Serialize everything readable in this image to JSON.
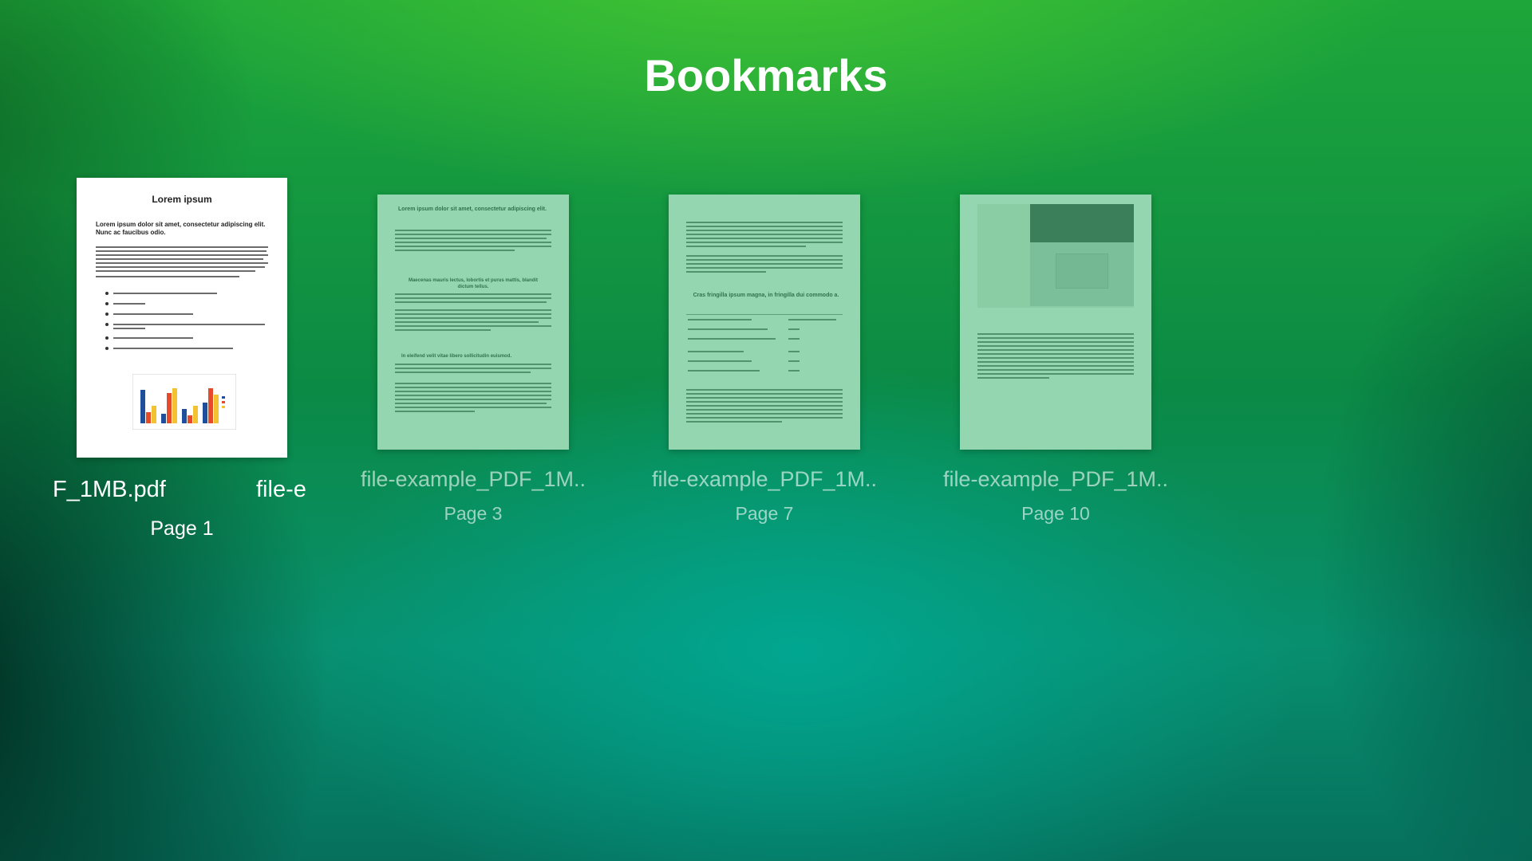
{
  "header": {
    "title": "Bookmarks"
  },
  "bookmarks": [
    {
      "file_marquee_left": "F_1MB.pdf",
      "file_marquee_right": "file-e",
      "page": "Page 1",
      "preview": {
        "heading": "Lorem ipsum",
        "subheading": "Lorem ipsum dolor sit amet, consectetur adipiscing elit. Nunc ac faucibus odio."
      }
    },
    {
      "file": "file-example_PDF_1M..",
      "page": "Page 3",
      "preview": {
        "heading": "Lorem ipsum dolor sit amet, consectetur adipiscing elit.",
        "heading2": "Maecenas mauris lectus, lobortis et purus mattis, blandit dictum tellus.",
        "heading3": "In eleifend velit vitae libero sollicitudin euismod."
      }
    },
    {
      "file": "file-example_PDF_1M..",
      "page": "Page 7",
      "preview": {
        "heading": "Cras fringilla ipsum magna, in fringilla dui commodo a."
      }
    },
    {
      "file": "file-example_PDF_1M..",
      "page": "Page 10"
    }
  ],
  "colors": {
    "background_top": "#1ea63a",
    "background_bottom": "#088f6f",
    "dim_overlay": "#3cb46e"
  }
}
